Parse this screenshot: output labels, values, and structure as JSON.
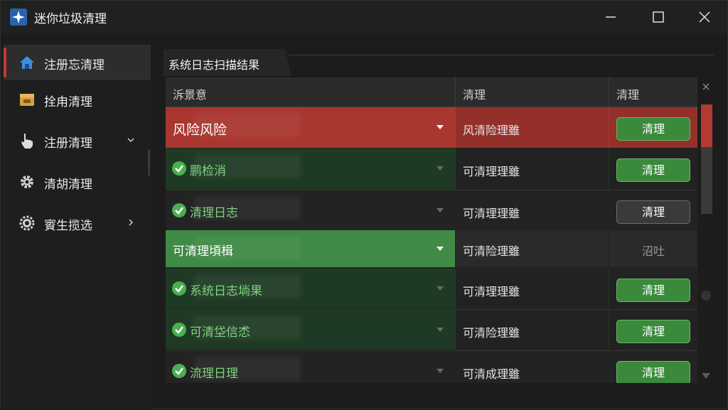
{
  "window": {
    "title": "迷你垃圾清理",
    "controls": {
      "minimize": "minimize",
      "maximize": "maximize",
      "close": "close"
    }
  },
  "sidebar": {
    "items": [
      {
        "label": "注册忘清理",
        "icon": "home-icon",
        "active": true
      },
      {
        "label": "拴甪清理",
        "icon": "box-icon",
        "active": false
      },
      {
        "label": "注册清理",
        "icon": "hand-pointer-icon",
        "active": false,
        "chevron": "down"
      },
      {
        "label": "清胡清理",
        "icon": "gear-icon",
        "active": false
      },
      {
        "label": "賨生揽选",
        "icon": "gear-circle-icon",
        "active": false,
        "chevron": "right"
      }
    ]
  },
  "panel": {
    "title": "系统日志扫描结果",
    "columns": [
      "泝景意",
      "清理",
      "清理"
    ],
    "rows": [
      {
        "name": "风险风险",
        "status": "风清险理雖",
        "action": "清理",
        "style": "red",
        "checked": false,
        "action_type": "green-button"
      },
      {
        "name": "鹏检消",
        "status": "可清理理雖",
        "action": "清理",
        "style": "dkgreen",
        "checked": true,
        "action_type": "green-button"
      },
      {
        "name": "清理日志",
        "status": "可清理理雖",
        "action": "清理",
        "style": "dark",
        "checked": true,
        "action_type": "gray-button"
      },
      {
        "name": "可清理頃楫",
        "status": "可清险理雖",
        "action": "沼吐",
        "style": "brightgreen",
        "checked": false,
        "action_type": "text"
      },
      {
        "name": "系统日志埫果",
        "status": "可清理理雖",
        "action": "清理",
        "style": "dkgreen",
        "checked": true,
        "action_type": "green-button"
      },
      {
        "name": "可清垈信怸",
        "status": "可清险理雖",
        "action": "清理",
        "style": "dkgreen",
        "checked": true,
        "action_type": "green-button"
      },
      {
        "name": "流理日理",
        "status": "可清成理雖",
        "action": "清理",
        "style": "dark",
        "checked": true,
        "action_type": "green-button"
      }
    ]
  },
  "colors": {
    "accent_red": "#c23a3a",
    "row_red": "#a9362f",
    "button_green": "#3b8a3b",
    "check_green": "#4caf50",
    "text_green": "#7fd07f"
  }
}
